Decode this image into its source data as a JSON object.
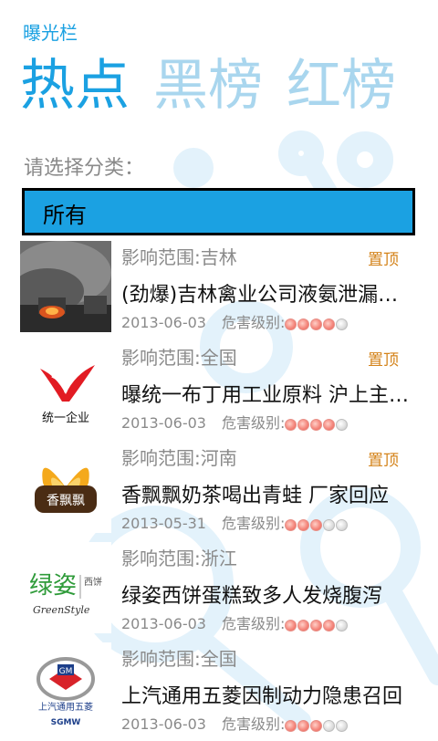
{
  "app": {
    "title": "曝光栏"
  },
  "pivot": {
    "tabs": [
      "热点",
      "黑榜",
      "红榜"
    ]
  },
  "filter": {
    "label": "请选择分类：",
    "selected": "所有"
  },
  "items": [
    {
      "scope": "影响范围:吉林",
      "pin": "置顶",
      "headline": "(劲爆)吉林禽业公司液氨泄漏爆炸事故",
      "date": "2013-06-03",
      "level_label": "危害级别:",
      "level": 4,
      "thumb": "fire-smoke-photo"
    },
    {
      "scope": "影响范围:全国",
      "pin": "置顶",
      "headline": "曝统一布丁用工业原料 沪上主要超市下架",
      "date": "2013-06-03",
      "level_label": "危害级别:",
      "level": 4,
      "thumb_text": "统一企业",
      "thumb": "uni-president-logo"
    },
    {
      "scope": "影响范围:河南",
      "pin": "置顶",
      "headline": "香飘飘奶茶喝出青蛙 厂家回应",
      "date": "2013-05-31",
      "level_label": "危害级别:",
      "level": 3,
      "thumb_text": "香飘飘",
      "thumb": "xiangpiaopiao-logo"
    },
    {
      "scope": "影响范围:浙江",
      "pin": "",
      "headline": "绿姿西饼蛋糕致多人发烧腹泻",
      "date": "2013-06-03",
      "level_label": "危害级别:",
      "level": 4,
      "thumb_text": "绿姿",
      "thumb_text2": "西饼",
      "thumb_text3": "GreenStyle",
      "thumb": "greenstyle-logo"
    },
    {
      "scope": "影响范围:全国",
      "pin": "",
      "headline": "上汽通用五菱因制动力隐患召回",
      "date": "2013-06-03",
      "level_label": "危害级别:",
      "level": 3,
      "thumb_text": "上汽通用五菱",
      "thumb_text2": "SGMW",
      "thumb_text3": "GM",
      "thumb": "sgmw-logo"
    }
  ],
  "colors": {
    "accent": "#1ba1e2",
    "pin": "#d4831a"
  }
}
